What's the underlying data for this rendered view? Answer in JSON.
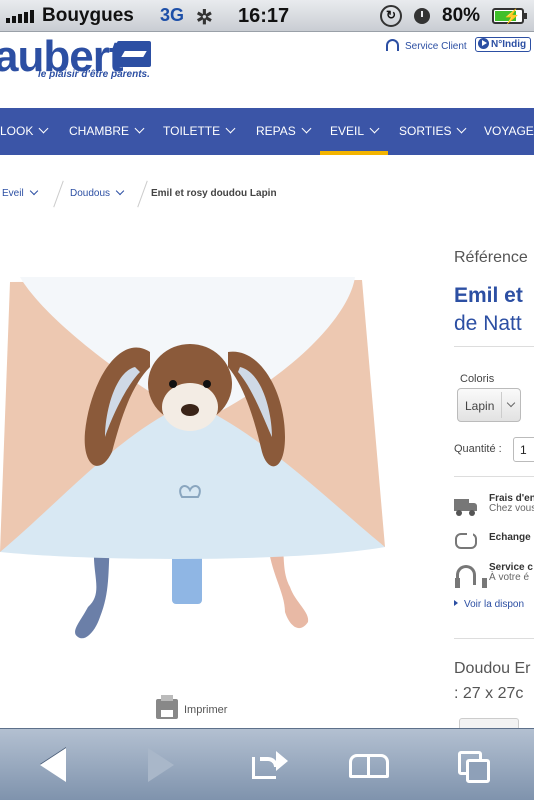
{
  "status_bar": {
    "carrier": "Bouygues",
    "network": "3G",
    "time": "16:17",
    "battery": "80%",
    "battery_level": 0.8
  },
  "header": {
    "logo": "aubert",
    "tagline": "le plaisir d'être parents.",
    "service_client": "Service Client",
    "indigo": "N°Indig"
  },
  "nav": {
    "items": [
      {
        "label": "LOOK",
        "active": false
      },
      {
        "label": "CHAMBRE",
        "active": false
      },
      {
        "label": "TOILETTE",
        "active": false
      },
      {
        "label": "REPAS",
        "active": false
      },
      {
        "label": "EVEIL",
        "active": true
      },
      {
        "label": "SORTIES",
        "active": false
      },
      {
        "label": "VOYAGES",
        "active": false
      }
    ],
    "accent_color": "#f3b400",
    "bg_color": "#3b55a7"
  },
  "breadcrumb": {
    "items": [
      "Eveil",
      "Doudous"
    ],
    "current": "Emil et rosy doudou Lapin"
  },
  "product": {
    "reference_label": "Référence",
    "title": "Emil et",
    "brand": "de Natt",
    "color_label": "Coloris",
    "color_value": "Lapin",
    "quantity_label": "Quantité :",
    "quantity_value": "1",
    "services": [
      {
        "icon": "truck-icon",
        "title": "Frais d'en",
        "subtitle": "Chez vous"
      },
      {
        "icon": "exchange-icon",
        "title": "Echange",
        "subtitle": ""
      },
      {
        "icon": "headset-icon",
        "title": "Service c",
        "subtitle": "À votre é"
      }
    ],
    "stock_link": "Voir la dispon",
    "description_line1": "Doudou Er",
    "description_line2": ": 27 x 27c",
    "print_label": "Imprimer"
  },
  "toolbar": {
    "buttons": [
      "back-icon",
      "forward-icon",
      "share-icon",
      "bookmarks-icon",
      "tabs-icon"
    ]
  }
}
